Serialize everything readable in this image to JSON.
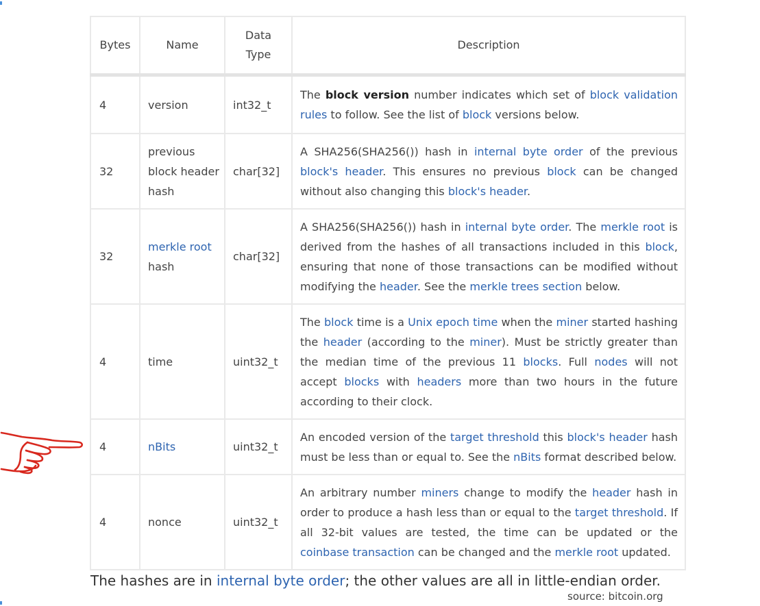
{
  "table": {
    "headers": {
      "bytes": "Bytes",
      "name": "Name",
      "data_type_1": "Data",
      "data_type_2": "Type",
      "description": "Description"
    },
    "rows": [
      {
        "bytes": "4",
        "name": "version",
        "type": "int32_t",
        "desc": [
          {
            "t": "The ",
            "s": "text"
          },
          {
            "t": "block version",
            "s": "bold"
          },
          {
            "t": " number indicates which set of ",
            "s": "text"
          },
          {
            "t": "block validation rules",
            "s": "link"
          },
          {
            "t": " to follow. See the list of ",
            "s": "text"
          },
          {
            "t": "block",
            "s": "link"
          },
          {
            "t": " versions below.",
            "s": "text"
          }
        ]
      },
      {
        "bytes": "32",
        "name": "previous block header hash",
        "type": "char[32]",
        "desc": [
          {
            "t": "A SHA256(SHA256()) hash in ",
            "s": "text"
          },
          {
            "t": "internal byte order",
            "s": "link"
          },
          {
            "t": " of the previous ",
            "s": "text"
          },
          {
            "t": "block's header",
            "s": "link"
          },
          {
            "t": ". This ensures no previous ",
            "s": "text"
          },
          {
            "t": "block",
            "s": "link"
          },
          {
            "t": " can be changed without also changing this ",
            "s": "text"
          },
          {
            "t": "block's header",
            "s": "link"
          },
          {
            "t": ".",
            "s": "text"
          }
        ]
      },
      {
        "bytes": "32",
        "name_parts": [
          {
            "t": "merkle root",
            "s": "link"
          },
          {
            "t": " hash",
            "s": "text"
          }
        ],
        "type": "char[32]",
        "desc": [
          {
            "t": "A SHA256(SHA256()) hash in ",
            "s": "text"
          },
          {
            "t": "internal byte order",
            "s": "link"
          },
          {
            "t": ". The ",
            "s": "text"
          },
          {
            "t": "merkle root",
            "s": "link"
          },
          {
            "t": " is derived from the hashes of all transactions included in this ",
            "s": "text"
          },
          {
            "t": "block",
            "s": "link"
          },
          {
            "t": ", ensuring that none of those transactions can be modified without modifying the ",
            "s": "text"
          },
          {
            "t": "header",
            "s": "link"
          },
          {
            "t": ". See the ",
            "s": "text"
          },
          {
            "t": "merkle trees section",
            "s": "link"
          },
          {
            "t": " below.",
            "s": "text"
          }
        ]
      },
      {
        "bytes": "4",
        "name": "time",
        "type": "uint32_t",
        "desc": [
          {
            "t": "The ",
            "s": "text"
          },
          {
            "t": "block",
            "s": "link"
          },
          {
            "t": " time is a ",
            "s": "text"
          },
          {
            "t": "Unix epoch time",
            "s": "link"
          },
          {
            "t": " when the ",
            "s": "text"
          },
          {
            "t": "miner",
            "s": "link"
          },
          {
            "t": " started hashing the ",
            "s": "text"
          },
          {
            "t": "header",
            "s": "link"
          },
          {
            "t": " (according to the ",
            "s": "text"
          },
          {
            "t": "miner",
            "s": "link"
          },
          {
            "t": "). Must be strictly greater than the median time of the previous 11 ",
            "s": "text"
          },
          {
            "t": "blocks",
            "s": "link"
          },
          {
            "t": ". Full ",
            "s": "text"
          },
          {
            "t": "nodes",
            "s": "link"
          },
          {
            "t": " will not accept ",
            "s": "text"
          },
          {
            "t": "blocks",
            "s": "link"
          },
          {
            "t": " with ",
            "s": "text"
          },
          {
            "t": "headers",
            "s": "link"
          },
          {
            "t": " more than two hours in the future according to their clock.",
            "s": "text"
          }
        ]
      },
      {
        "bytes": "4",
        "name_parts": [
          {
            "t": "nBits",
            "s": "link"
          }
        ],
        "type": "uint32_t",
        "desc": [
          {
            "t": "An encoded version of the ",
            "s": "text"
          },
          {
            "t": "target threshold",
            "s": "link"
          },
          {
            "t": " this ",
            "s": "text"
          },
          {
            "t": "block's header",
            "s": "link"
          },
          {
            "t": " hash must be less than or equal to. See the ",
            "s": "text"
          },
          {
            "t": "nBits",
            "s": "link"
          },
          {
            "t": " format described below.",
            "s": "text"
          }
        ]
      },
      {
        "bytes": "4",
        "name": "nonce",
        "type": "uint32_t",
        "desc": [
          {
            "t": "An arbitrary number ",
            "s": "text"
          },
          {
            "t": "miners",
            "s": "link"
          },
          {
            "t": " change to modify the ",
            "s": "text"
          },
          {
            "t": "header",
            "s": "link"
          },
          {
            "t": " hash in order to produce a hash less than or equal to the ",
            "s": "text"
          },
          {
            "t": "target threshold",
            "s": "link"
          },
          {
            "t": ". If all 32-bit values are tested, the time can be updated or the ",
            "s": "text"
          },
          {
            "t": "coinbase transaction",
            "s": "link"
          },
          {
            "t": " can be changed and the ",
            "s": "text"
          },
          {
            "t": "merkle root",
            "s": "link"
          },
          {
            "t": " updated.",
            "s": "text"
          }
        ]
      }
    ]
  },
  "footnote": {
    "before": "The hashes are in ",
    "link": "internal byte order",
    "after": "; the other values are all in little-endian order."
  },
  "source": "source: bitcoin.org",
  "pointer": {
    "icon": "pointing-hand-icon",
    "color": "#d8281e"
  },
  "colors": {
    "link": "#2e64b0",
    "border": "#e9e9e9",
    "text": "#444444"
  }
}
